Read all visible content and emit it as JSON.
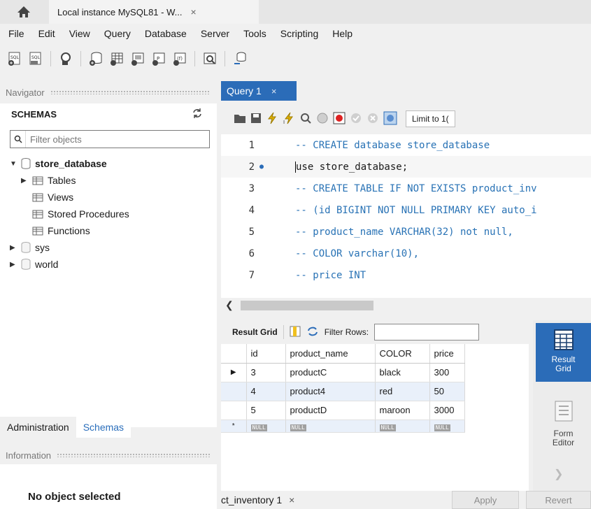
{
  "window": {
    "tab_title": "Local instance MySQL81 - W...",
    "close": "×"
  },
  "menu": [
    "File",
    "Edit",
    "View",
    "Query",
    "Database",
    "Server",
    "Tools",
    "Scripting",
    "Help"
  ],
  "toolbar_icons": [
    "new-sql-tab-icon",
    "open-sql-script-icon",
    "inspector-icon",
    "create-schema-icon",
    "create-table-icon",
    "create-view-icon",
    "create-procedure-icon",
    "create-function-icon",
    "search-table-data-icon",
    "reconnect-icon"
  ],
  "navigator": {
    "header": "Navigator",
    "schemas_title": "SCHEMAS",
    "filter_placeholder": "Filter objects",
    "tree": {
      "db": "store_database",
      "children": [
        "Tables",
        "Views",
        "Stored Procedures",
        "Functions"
      ],
      "others": [
        "sys",
        "world"
      ]
    },
    "tabs": [
      "Administration",
      "Schemas"
    ]
  },
  "information": {
    "header": "Information",
    "text": "No object selected"
  },
  "query": {
    "tab_label": "Query 1",
    "limit_label": "Limit to 1(",
    "lines": [
      {
        "n": "1",
        "text": "-- CREATE database store_database",
        "comment": true
      },
      {
        "n": "2",
        "text": "use store_database;",
        "comment": false,
        "marker": "●"
      },
      {
        "n": "3",
        "text": "-- CREATE TABLE IF NOT EXISTS product_inv",
        "comment": true
      },
      {
        "n": "4",
        "text": "-- (id BIGINT NOT NULL PRIMARY KEY auto_i",
        "comment": true
      },
      {
        "n": "5",
        "text": "-- product_name VARCHAR(32) not null,",
        "comment": true
      },
      {
        "n": "6",
        "text": "-- COLOR varchar(10),",
        "comment": true
      },
      {
        "n": "7",
        "text": "-- price INT",
        "comment": true
      }
    ]
  },
  "results": {
    "grid_label": "Result Grid",
    "filter_label": "Filter Rows:",
    "columns": [
      "id",
      "product_name",
      "COLOR",
      "price"
    ],
    "rows": [
      {
        "id": "3",
        "product_name": "productC",
        "color": "black",
        "price": "300"
      },
      {
        "id": "4",
        "product_name": "product4",
        "color": "red",
        "price": "50"
      },
      {
        "id": "5",
        "product_name": "productD",
        "color": "maroon",
        "price": "3000"
      }
    ],
    "null": "NULL",
    "new_row_marker": "*",
    "result_tab": "ct_inventory 1",
    "apply": "Apply",
    "revert": "Revert"
  },
  "side_panel": {
    "result_grid_l1": "Result",
    "result_grid_l2": "Grid",
    "form_editor_l1": "Form",
    "form_editor_l2": "Editor"
  },
  "colors": {
    "accent": "#2b6cb8",
    "comment": "#2872b5"
  }
}
